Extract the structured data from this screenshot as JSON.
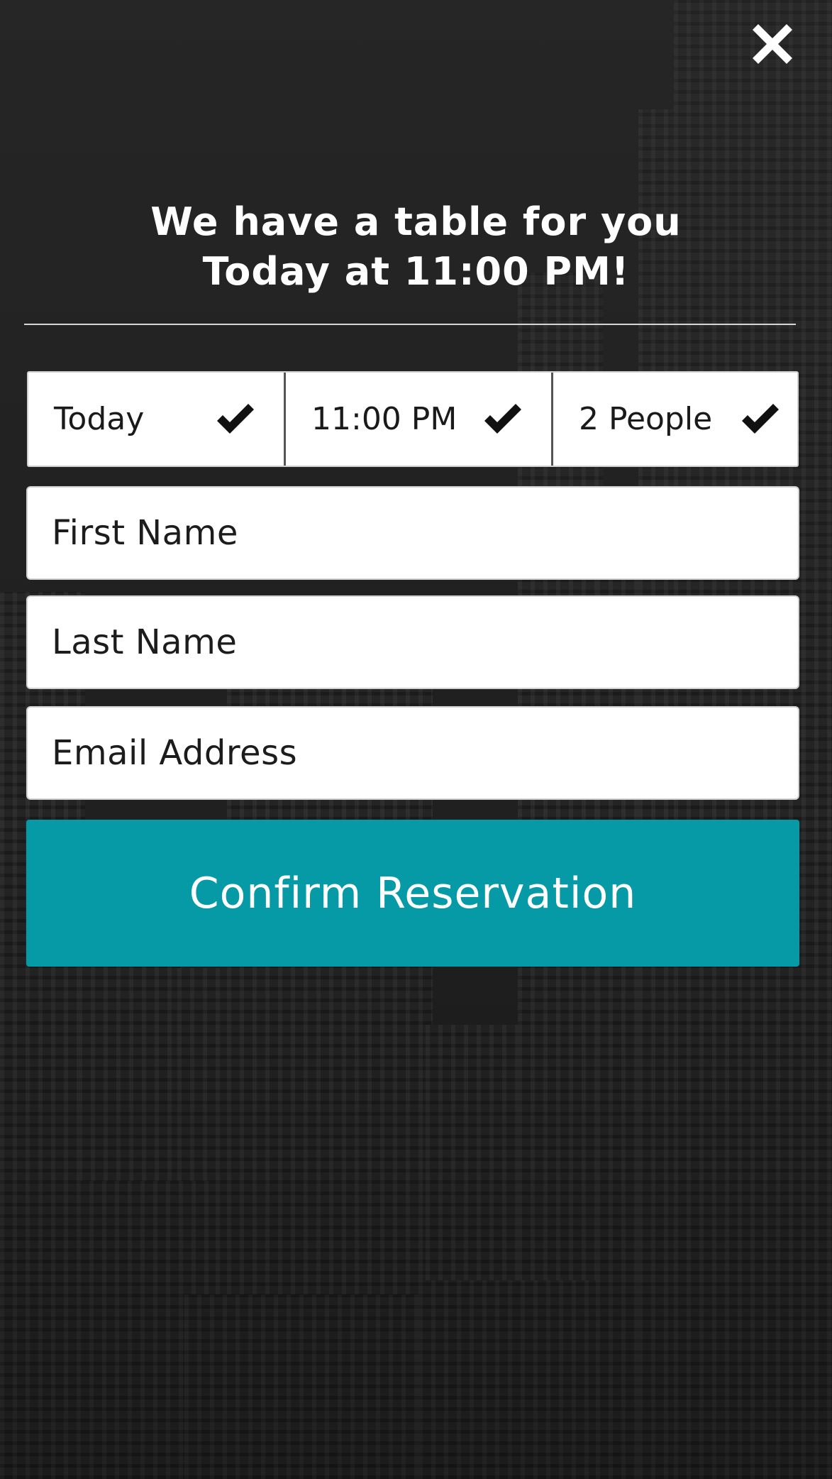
{
  "header": {
    "close_icon": "close-icon",
    "headline_line1": "We have a table for you",
    "headline_line2": "Today at 11:00 PM!"
  },
  "selectors": {
    "date": {
      "label": "Today",
      "icon": "check-icon"
    },
    "time": {
      "label": "11:00 PM",
      "icon": "check-icon"
    },
    "party": {
      "label": "2 People",
      "icon": "check-icon"
    }
  },
  "form": {
    "first_name_placeholder": "First Name",
    "last_name_placeholder": "Last Name",
    "email_placeholder": "Email Address",
    "confirm_label": "Confirm Reservation"
  },
  "colors": {
    "accent": "#069aa6",
    "background": "#232323",
    "text_light": "#ffffff",
    "text_dark": "#1a1a1a"
  }
}
